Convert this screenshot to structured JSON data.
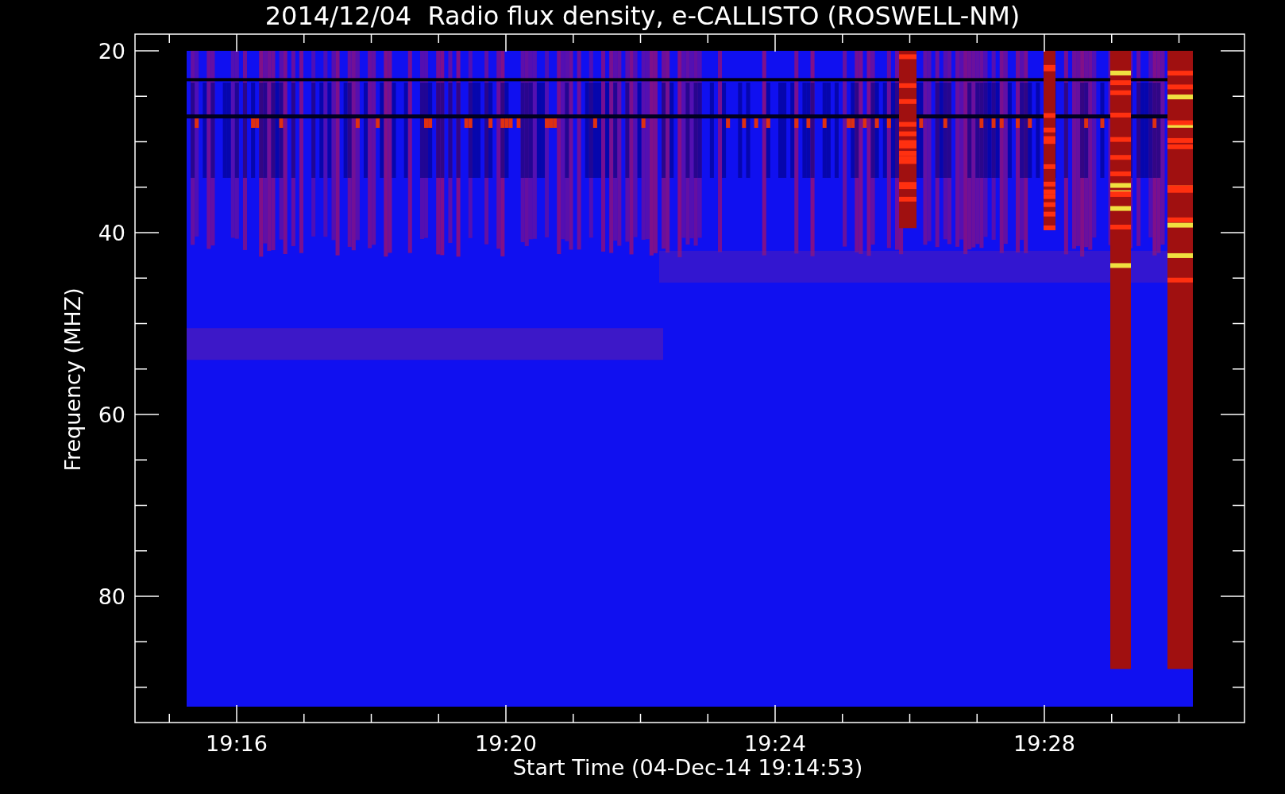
{
  "title": "2014/12/04  Radio flux density, e-CALLISTO (ROSWELL-NM)",
  "y_axis": {
    "label": "Frequency (MHZ)",
    "ticks": [
      "20",
      "40",
      "60",
      "80"
    ]
  },
  "x_axis": {
    "label": "Start Time (04-Dec-14 19:14:53)",
    "ticks": [
      "19:16",
      "19:20",
      "19:24",
      "19:28"
    ]
  }
}
